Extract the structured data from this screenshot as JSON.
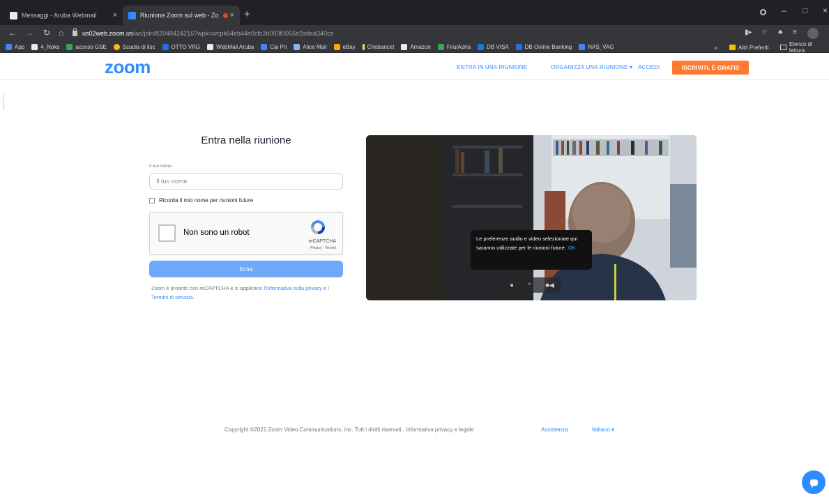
{
  "browser": {
    "tabs": [
      {
        "title": "Messaggi - Aruba Webmail",
        "close": "×",
        "icon": "webmail-icon"
      },
      {
        "title": "Riunione Zoom sul web - Zo",
        "close": "×",
        "icon": "zoom-icon"
      }
    ],
    "new_tab": "+",
    "url_host": "us02web.zoom.us",
    "url_path": "/wc/join/82049424216?wpk=wcpk64eb44e0cfc3d093f0055e2adea340ce",
    "bookmarks": [
      "App",
      "4_Noks",
      "acceso GSE",
      "Scuola di lisc",
      "OTTO VRG",
      "WebMail Aruba",
      "Cai Pn",
      "Alice Mail",
      "eBay",
      "Chebanca!",
      "Amazon",
      "FriulAdria",
      "DB VISA",
      "DB Online Banking",
      "NAS_VAG"
    ],
    "bookmarks_more": "»",
    "other_bookmarks": "Altri Preferiti",
    "reading_list": "Elenco di lettura",
    "colors": {
      "tab_strip": "#202124",
      "toolbar": "#35363a"
    }
  },
  "zoom": {
    "logo": "zoom",
    "nav": {
      "join": "ENTRA IN UNA RIUNIONE",
      "host": "organizzA UNA RIUNIONE ▾",
      "signin": "ACCEDI",
      "signup": "ISCRIVITI, È GRATIS"
    },
    "join": {
      "title": "Entra nella riunione",
      "name_label": "Il tuo nome",
      "name_placeholder": "Il tuo nome",
      "name_value": "",
      "remember_label": "Ricorda il mio nome per riunioni future",
      "button": "Entra",
      "legal_prefix": "Zoom è protetto con reCAPTCHA e si applicano l'",
      "legal_privacy": "Informativa sulla privacy",
      "legal_and": " e i ",
      "legal_terms": "Termini di servizio",
      "legal_suffix": "."
    },
    "captcha": {
      "label": "Non sono un robot",
      "brand": "reCAPTCHA",
      "links": "Privacy - Termini"
    },
    "preview": {
      "tooltip": "Le preferenze audio e video selezionate qui saranno utilizzate per le riunioni future.",
      "tooltip_ok": "OK",
      "caret": "^"
    },
    "footer": {
      "copyright": "Copyright ©2021 Zoom Video Communications, Inc. Tutt i diritti riservati.. Informativa privacy e legale",
      "help": "Assistenza",
      "language": "Italiano ▾"
    },
    "colors": {
      "brand_blue": "#2d8cff",
      "signup_orange": "#ff7a2f",
      "join_button": "#6ea8f8"
    }
  }
}
